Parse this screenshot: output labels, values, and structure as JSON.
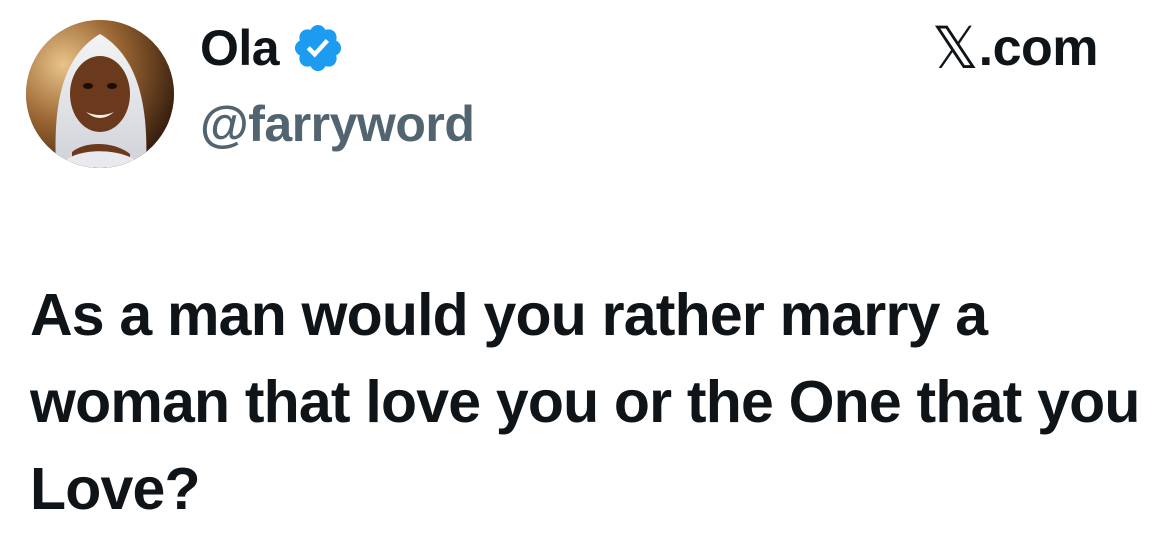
{
  "author": {
    "display_name": "Ola",
    "handle": "@farryword",
    "verified": true,
    "verified_color": "#1d9bf0",
    "avatar_icon": "profile-photo"
  },
  "brand": {
    "logo_glyph": "𝕏",
    "domain": ".com"
  },
  "tweet": {
    "text": "As a man would you rather marry a woman that love you or the One that you Love?"
  },
  "colors": {
    "text_primary": "#0f1419",
    "text_secondary": "#536471",
    "background": "#ffffff"
  }
}
